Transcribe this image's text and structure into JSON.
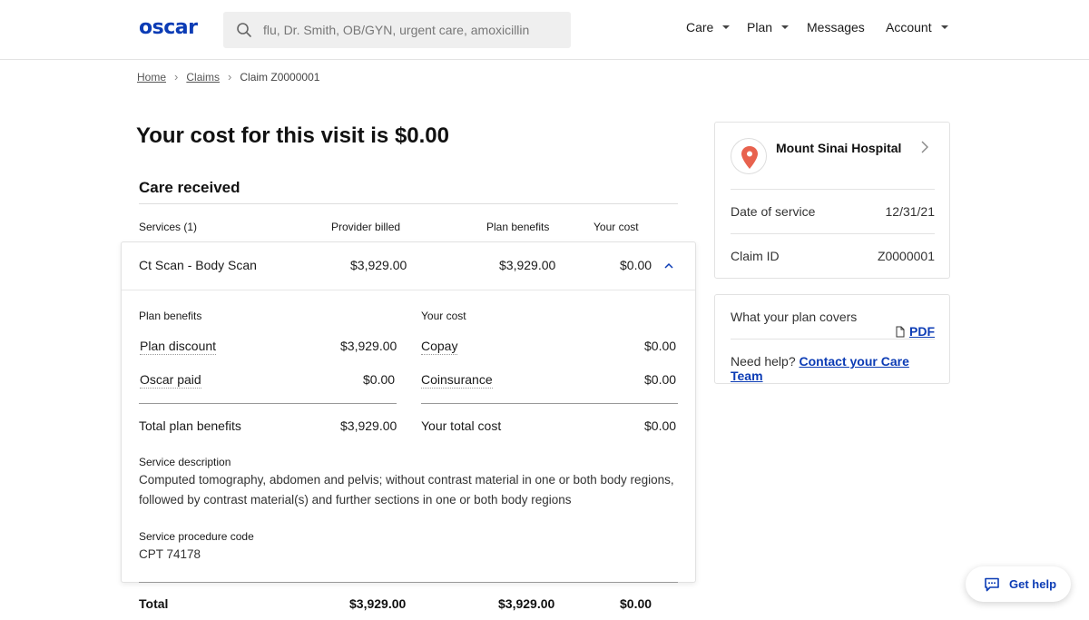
{
  "header": {
    "logo": "oscar",
    "search_placeholder": "flu, Dr. Smith, OB/GYN, urgent care, amoxicillin",
    "nav": [
      "Care",
      "Plan",
      "Messages",
      "Account"
    ]
  },
  "breadcrumb": {
    "home": "Home",
    "claims": "Claims",
    "current": "Claim Z0000001"
  },
  "main": {
    "title": "Your cost for this visit is $0.00",
    "section_title": "Care received",
    "columns": {
      "services": "Services (1)",
      "provider_billed": "Provider billed",
      "plan_benefits": "Plan benefits",
      "your_cost": "Your cost"
    },
    "service_row": {
      "name": "Ct Scan - Body Scan",
      "provider_billed": "$3,929.00",
      "plan_benefits": "$3,929.00",
      "your_cost": "$0.00"
    },
    "details": {
      "plan_benefits_heading": "Plan benefits",
      "your_cost_heading": "Your cost",
      "plan_discount_label": "Plan discount",
      "plan_discount_value": "$3,929.00",
      "oscar_paid_label": "Oscar paid",
      "oscar_paid_value": "$0.00",
      "copay_label": "Copay",
      "copay_value": "$0.00",
      "coinsurance_label": "Coinsurance",
      "coinsurance_value": "$0.00",
      "total_plan_benefits_label": "Total plan benefits",
      "total_plan_benefits_value": "$3,929.00",
      "your_total_cost_label": "Your total cost",
      "your_total_cost_value": "$0.00",
      "service_description_heading": "Service description",
      "service_description": "Computed tomography, abdomen and pelvis; without contrast material in one or both body regions, followed by contrast material(s) and further sections in one or both body regions",
      "procedure_code_heading": "Service procedure code",
      "procedure_code": "CPT 74178"
    },
    "total": {
      "label": "Total",
      "provider_billed": "$3,929.00",
      "plan_benefits": "$3,929.00",
      "your_cost": "$0.00"
    }
  },
  "sidebar": {
    "hospital": "Mount Sinai Hospital",
    "date_label": "Date of service",
    "date_value": "12/31/21",
    "claim_label": "Claim ID",
    "claim_value": "Z0000001",
    "covers_label": "What your plan covers",
    "pdf_label": "PDF",
    "help_label": "Need help?",
    "help_link": "Contact your Care Team"
  },
  "fab": {
    "label": "Get help"
  },
  "colors": {
    "brand": "#0c3cb5",
    "pin": "#e8624e"
  },
  "icons": [
    "search-icon",
    "chevron-down-icon",
    "chevron-right-icon",
    "chevron-up-icon",
    "location-pin-icon",
    "document-icon",
    "chat-icon"
  ]
}
